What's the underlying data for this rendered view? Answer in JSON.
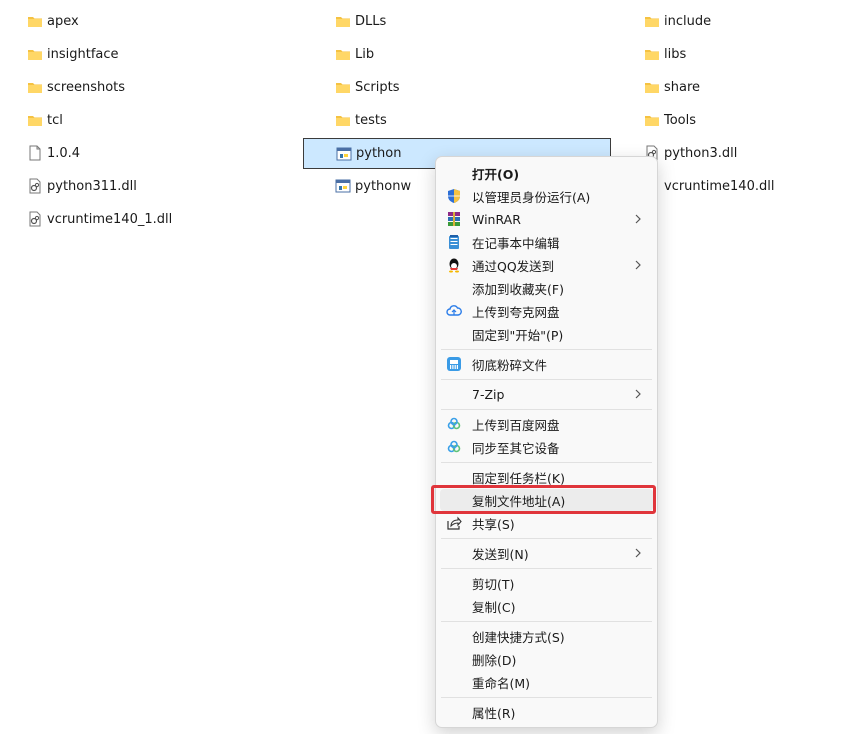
{
  "files": [
    {
      "name": "apex",
      "type": "folder"
    },
    {
      "name": "DLLs",
      "type": "folder"
    },
    {
      "name": "include",
      "type": "folder"
    },
    {
      "name": "insightface",
      "type": "folder"
    },
    {
      "name": "Lib",
      "type": "folder"
    },
    {
      "name": "libs",
      "type": "folder"
    },
    {
      "name": "screenshots",
      "type": "folder"
    },
    {
      "name": "Scripts",
      "type": "folder"
    },
    {
      "name": "share",
      "type": "folder"
    },
    {
      "name": "tcl",
      "type": "folder"
    },
    {
      "name": "tests",
      "type": "folder"
    },
    {
      "name": "Tools",
      "type": "folder"
    },
    {
      "name": "1.0.4",
      "type": "file"
    },
    {
      "name": "python",
      "type": "exe",
      "selected": true
    },
    {
      "name": "python3.dll",
      "type": "dll"
    },
    {
      "name": "python311.dll",
      "type": "dll"
    },
    {
      "name": "pythonw",
      "type": "exe"
    },
    {
      "name": "vcruntime140.dll",
      "type": "dll"
    },
    {
      "name": "vcruntime140_1.dll",
      "type": "dll"
    }
  ],
  "context_menu": {
    "items": [
      {
        "label": "打开(O)",
        "bold": true,
        "icon": "none"
      },
      {
        "label": "以管理员身份运行(A)",
        "icon": "uac-shield-icon"
      },
      {
        "label": "WinRAR",
        "icon": "winrar-icon",
        "submenu": true
      },
      {
        "label": "在记事本中编辑",
        "icon": "notepad-icon"
      },
      {
        "label": "通过QQ发送到",
        "icon": "qq-icon",
        "submenu": true
      },
      {
        "label": "添加到收藏夹(F)",
        "icon": "none"
      },
      {
        "label": "上传到夸克网盘",
        "icon": "quark-cloud-icon"
      },
      {
        "label": "固定到\"开始\"(P)",
        "icon": "none"
      },
      {
        "label": "彻底粉碎文件",
        "icon": "shredder-icon"
      },
      {
        "label": "7-Zip",
        "icon": "none",
        "submenu": true
      },
      {
        "label": "上传到百度网盘",
        "icon": "baidu-cloud-icon"
      },
      {
        "label": "同步至其它设备",
        "icon": "baidu-sync-icon"
      },
      {
        "label": "固定到任务栏(K)",
        "icon": "none"
      },
      {
        "label": "复制文件地址(A)",
        "icon": "none",
        "highlighted": true
      },
      {
        "label": "共享(S)",
        "icon": "share-icon"
      },
      {
        "label": "发送到(N)",
        "icon": "none",
        "submenu": true
      },
      {
        "label": "剪切(T)",
        "icon": "none"
      },
      {
        "label": "复制(C)",
        "icon": "none"
      },
      {
        "label": "创建快捷方式(S)",
        "icon": "none"
      },
      {
        "label": "删除(D)",
        "icon": "none"
      },
      {
        "label": "重命名(M)",
        "icon": "none"
      },
      {
        "label": "属性(R)",
        "icon": "none"
      }
    ]
  },
  "colors": {
    "folder": "#f5c242",
    "selection_bg": "#cce8ff",
    "highlight_border": "#e0353b"
  }
}
